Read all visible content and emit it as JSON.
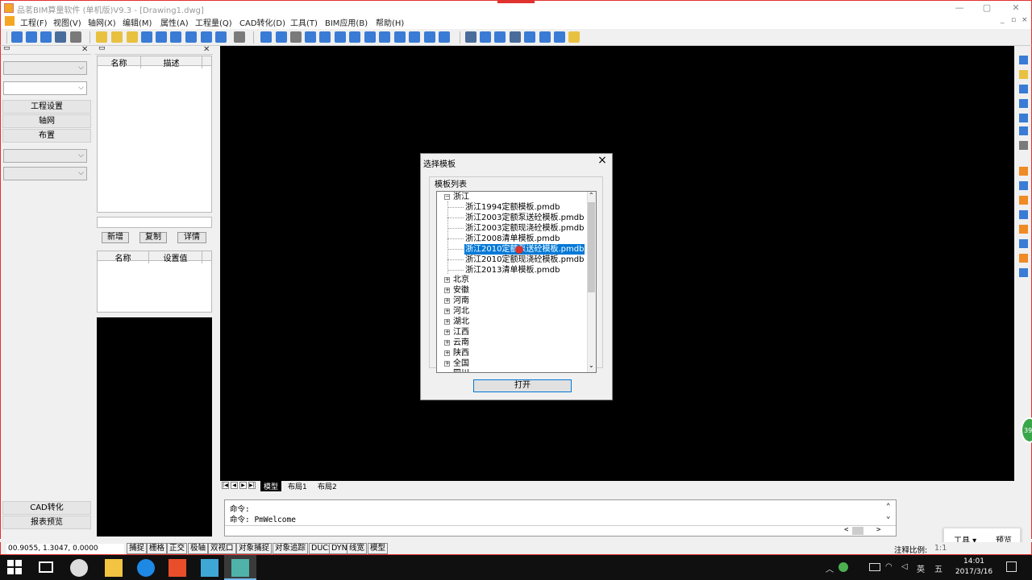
{
  "window": {
    "title": "品茗BIM算量软件 (单机版)V9.3 - [Drawing1.dwg]",
    "min": "—",
    "max": "▢",
    "close": "✕"
  },
  "menu": [
    "工程(F)",
    "视图(V)",
    "轴网(X)",
    "编辑(M)",
    "属性(A)",
    "工程量(Q)",
    "CAD转化(D)",
    "工具(T)",
    "BIM应用(B)",
    "帮助(H)"
  ],
  "mdi_controls": [
    "_",
    "▫",
    "×"
  ],
  "left_panel": {
    "nav_buttons": [
      "工程设置",
      "轴网",
      "布置"
    ],
    "bottom_buttons": [
      "CAD转化",
      "报表预览"
    ]
  },
  "props_panel": {
    "top_headers": [
      "名称",
      "描述"
    ],
    "buttons": [
      "新增",
      "复制",
      "详情"
    ],
    "bottom_headers": [
      "名称",
      "设置值"
    ]
  },
  "layout_tabs": [
    "模型",
    "布局1",
    "布局2"
  ],
  "command": {
    "lines": [
      "命令:",
      "命令: PmWelcome"
    ]
  },
  "status": {
    "coords": "00.9055, 1.3047, 0.0000",
    "toggles": [
      "捕捉",
      "栅格",
      "正交",
      "极轴",
      "双视口",
      "对象捕捉",
      "对象追踪",
      "DUCS",
      "DYN",
      "线宽",
      "模型"
    ],
    "scale_label": "注释比例:",
    "scale_value": "1:1"
  },
  "dialog": {
    "title": "选择模板",
    "group_label": "模板列表",
    "tree": {
      "root": "浙江",
      "children": [
        "浙江1994定额模板.pmdb",
        "浙江2003定额泵送砼模板.pmdb",
        "浙江2003定额现浇砼模板.pmdb",
        "浙江2008清单模板.pmdb",
        "浙江2010定额泵送砼模板.pmdb",
        "浙江2010定额现浇砼模板.pmdb",
        "浙江2013清单模板.pmdb"
      ],
      "selected_index": 4,
      "provinces": [
        "北京",
        "安徽",
        "河南",
        "河北",
        "湖北",
        "江西",
        "云南",
        "陕西",
        "全国",
        "四川"
      ]
    },
    "open_button": "打开"
  },
  "widget": {
    "tools": "工具 ▾",
    "preview": "预览"
  },
  "bubble": "39",
  "taskbar": {
    "time": "14:01",
    "date": "2017/3/16",
    "ime": "英",
    "ime2": "五"
  },
  "colors": {
    "accent": "#0078d7",
    "window_border": "#e0322f",
    "canvas": "#000000"
  }
}
